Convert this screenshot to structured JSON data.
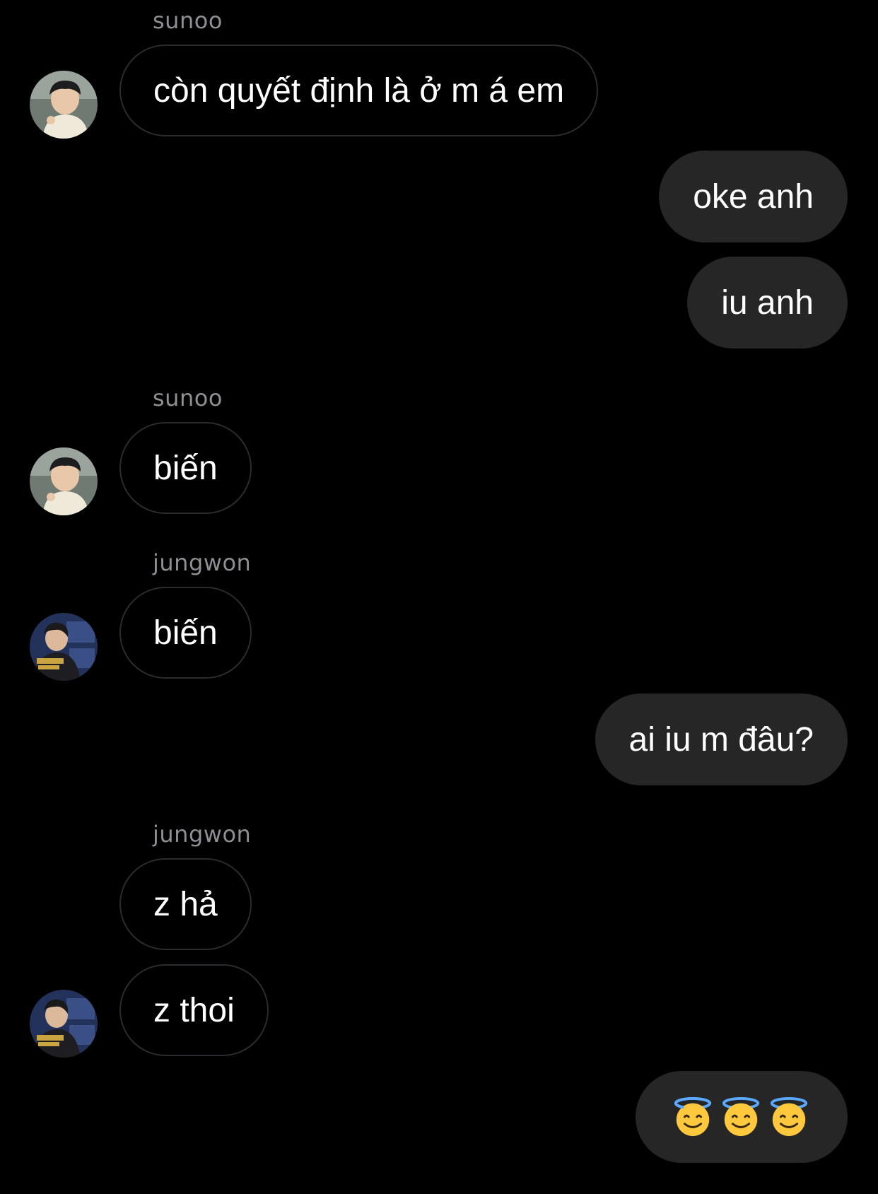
{
  "messages": [
    {
      "sender": "sunoo",
      "text": "còn quyết định là ở m á em"
    },
    {
      "text": "oke anh"
    },
    {
      "text": "iu anh"
    },
    {
      "sender": "sunoo",
      "text": "biến"
    },
    {
      "sender": "jungwon",
      "text": "biến"
    },
    {
      "text": "ai iu m đâu?"
    },
    {
      "sender": "jungwon",
      "text": "z hả"
    },
    {
      "text": "z thoi"
    },
    {
      "emoji": [
        "smiling-face-with-halo",
        "smiling-face-with-halo",
        "smiling-face-with-halo"
      ]
    }
  ],
  "colors": {
    "background": "#000000",
    "outgoing_bubble": "#262626",
    "incoming_border": "#2c2c2e",
    "sender_text": "#8e8e93",
    "message_text": "#ffffff"
  },
  "avatars": {
    "sunoo": "avatar-sunoo",
    "jungwon": "avatar-jungwon"
  }
}
